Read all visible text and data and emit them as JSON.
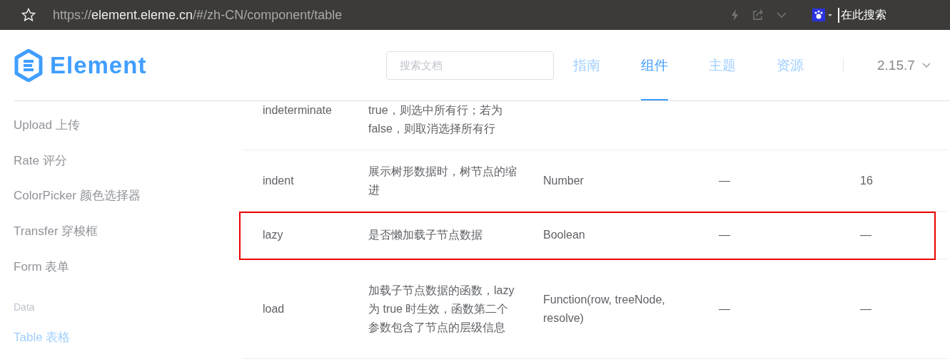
{
  "browser": {
    "url_scheme": "https://",
    "url_host": "element.eleme.cn",
    "url_path": "/#/zh-CN/component/table",
    "search_placeholder": "在此搜索"
  },
  "header": {
    "logo": "Element",
    "search": {
      "placeholder": "搜索文档"
    },
    "nav": [
      {
        "label": "指南",
        "selected": false
      },
      {
        "label": "组件",
        "selected": true
      },
      {
        "label": "主题",
        "selected": false
      },
      {
        "label": "资源",
        "selected": false
      }
    ],
    "version": "2.15.7"
  },
  "sidebar": {
    "items": [
      {
        "kind": "link",
        "label": "Upload 上传",
        "selected": false
      },
      {
        "kind": "link",
        "label": "Rate 评分",
        "selected": false
      },
      {
        "kind": "link",
        "label": "ColorPicker 颜色选择器",
        "selected": false
      },
      {
        "kind": "link",
        "label": "Transfer 穿梭框",
        "selected": false
      },
      {
        "kind": "link",
        "label": "Form 表单",
        "selected": false
      },
      {
        "kind": "group",
        "label": "Data"
      },
      {
        "kind": "link",
        "label": "Table 表格",
        "selected": true
      }
    ]
  },
  "table": {
    "rows": [
      {
        "cells": [
          "indeterminate",
          "true，则选中所有行；若为 false，则取消选择所有行",
          "",
          "",
          ""
        ],
        "highlighted": false
      },
      {
        "cells": [
          "indent",
          "展示树形数据时，树节点的缩进",
          "Number",
          "—",
          "16"
        ],
        "highlighted": false
      },
      {
        "cells": [
          "lazy",
          "是否懒加载子节点数据",
          "Boolean",
          "—",
          "—"
        ],
        "highlighted": true
      },
      {
        "cells": [
          "load",
          "加载子节点数据的函数，lazy 为 true 时生效，函数第二个参数包含了节点的层级信息",
          "Function(row, treeNode, resolve)",
          "—",
          "—"
        ],
        "highlighted": false
      }
    ]
  }
}
